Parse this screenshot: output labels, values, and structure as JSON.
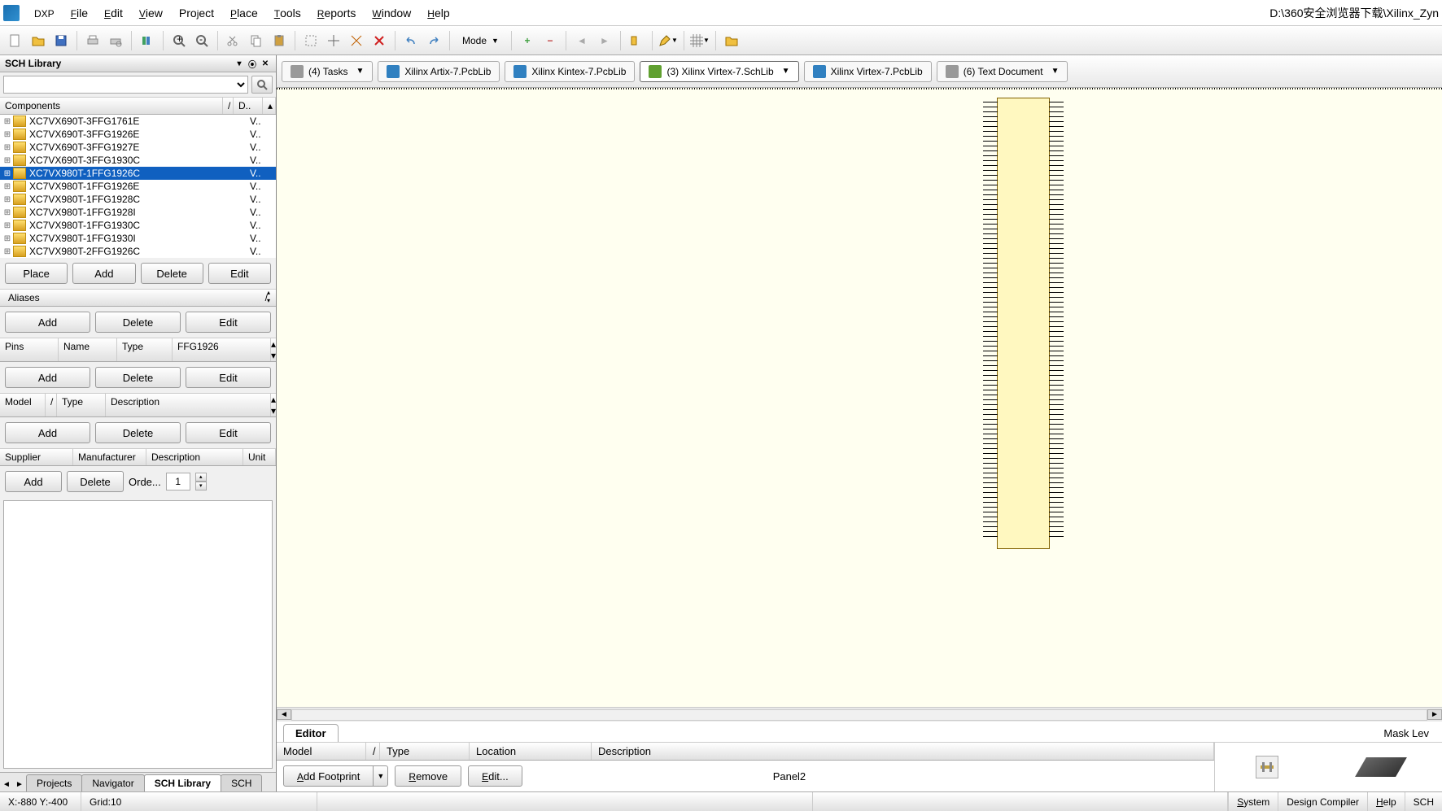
{
  "filepath": "D:\\360安全浏览器下载\\Xilinx_Zyn",
  "menubar": {
    "dxp": "DXP",
    "file": "File",
    "edit": "Edit",
    "view": "View",
    "project": "Project",
    "place": "Place",
    "tools": "Tools",
    "reports": "Reports",
    "window": "Window",
    "help": "Help"
  },
  "toolbar": {
    "mode_label": "Mode"
  },
  "left": {
    "panel_title": "SCH Library",
    "components_label": "Components",
    "desc_col": "D..",
    "items": [
      {
        "name": "XC7VX690T-3FFG1761E",
        "d": "V..",
        "sel": false
      },
      {
        "name": "XC7VX690T-3FFG1926E",
        "d": "V..",
        "sel": false
      },
      {
        "name": "XC7VX690T-3FFG1927E",
        "d": "V..",
        "sel": false
      },
      {
        "name": "XC7VX690T-3FFG1930C",
        "d": "V..",
        "sel": false
      },
      {
        "name": "XC7VX980T-1FFG1926C",
        "d": "V..",
        "sel": true
      },
      {
        "name": "XC7VX980T-1FFG1926E",
        "d": "V..",
        "sel": false
      },
      {
        "name": "XC7VX980T-1FFG1928C",
        "d": "V..",
        "sel": false
      },
      {
        "name": "XC7VX980T-1FFG1928I",
        "d": "V..",
        "sel": false
      },
      {
        "name": "XC7VX980T-1FFG1930C",
        "d": "V..",
        "sel": false
      },
      {
        "name": "XC7VX980T-1FFG1930I",
        "d": "V..",
        "sel": false
      },
      {
        "name": "XC7VX980T-2FFG1926C",
        "d": "V..",
        "sel": false
      }
    ],
    "btns": {
      "place": "Place",
      "add": "Add",
      "delete": "Delete",
      "edit": "Edit"
    },
    "aliases_label": "Aliases",
    "aliases_slash": "/",
    "alias_btns": {
      "add": "Add",
      "delete": "Delete",
      "edit": "Edit"
    },
    "pins": {
      "pins": "Pins",
      "name": "Name",
      "type": "Type",
      "value": "FFG1926"
    },
    "pins_btns": {
      "add": "Add",
      "delete": "Delete",
      "edit": "Edit"
    },
    "model": {
      "model": "Model",
      "slash": "/",
      "type": "Type",
      "desc": "Description"
    },
    "model_btns": {
      "add": "Add",
      "delete": "Delete",
      "edit": "Edit"
    },
    "supplier": {
      "supplier": "Supplier",
      "manufacturer": "Manufacturer",
      "description": "Description",
      "unit": "Unit"
    },
    "supplier_btns": {
      "add": "Add",
      "delete": "Delete",
      "order": "Orde...",
      "qty": "1"
    },
    "bottom_tabs": {
      "projects": "Projects",
      "navigator": "Navigator",
      "schlib": "SCH Library",
      "sch": "SCH"
    }
  },
  "doc_tabs": [
    {
      "label": "(4) Tasks",
      "icon": "gray",
      "active": false,
      "arrow": true
    },
    {
      "label": "Xilinx Artix-7.PcbLib",
      "icon": "blue",
      "active": false,
      "arrow": false
    },
    {
      "label": "Xilinx Kintex-7.PcbLib",
      "icon": "blue",
      "active": false,
      "arrow": false
    },
    {
      "label": "(3) Xilinx Virtex-7.SchLib",
      "icon": "green",
      "active": true,
      "arrow": true
    },
    {
      "label": "Xilinx Virtex-7.PcbLib",
      "icon": "blue",
      "active": false,
      "arrow": false
    },
    {
      "label": "(6) Text Document",
      "icon": "gray",
      "active": false,
      "arrow": true
    }
  ],
  "editor": {
    "tab": "Editor",
    "mask": "Mask Lev",
    "model_cols": {
      "model": "Model",
      "slash": "/",
      "type": "Type",
      "location": "Location",
      "description": "Description"
    },
    "panel2": "Panel2",
    "btns": {
      "add_footprint": "Add Footprint",
      "remove": "Remove",
      "edit": "Edit..."
    }
  },
  "status": {
    "coords": "X:-880 Y:-400",
    "grid": "Grid:10",
    "system": "System",
    "design_compiler": "Design Compiler",
    "help": "Help",
    "sch": "SCH"
  }
}
